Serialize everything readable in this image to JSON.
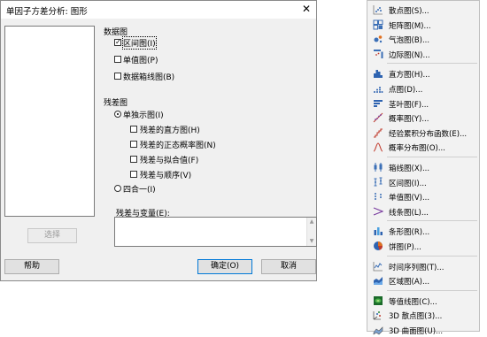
{
  "dialog": {
    "title": "单因子方差分析: 图形",
    "close": "✕",
    "select_button": "选择",
    "data_plots_heading": "数据图",
    "data_plots": [
      {
        "label": "区间图(I)",
        "checked": true
      },
      {
        "label": "单值图(P)",
        "checked": false
      },
      {
        "label": "数据箱线图(B)",
        "checked": false
      }
    ],
    "residual_heading": "残差图",
    "residual_options": {
      "individual": "单独示图(I)",
      "individual_selected": true,
      "items": [
        "残差的直方图(H)",
        "残差的正态概率图(N)",
        "残差与拟合值(F)",
        "残差与顺序(V)"
      ],
      "four_in_one": "四合一(I)"
    },
    "residual_vs_vars_label": "残差与变量(E):",
    "help_button": "帮助",
    "ok_button": "确定(O)",
    "cancel_button": "取消"
  },
  "menu": {
    "groups": [
      [
        {
          "label": "散点图(S)...",
          "icon": "scatter-icon",
          "color": "#3b6fb6"
        },
        {
          "label": "矩阵图(M)...",
          "icon": "matrix-icon",
          "color": "#3b6fb6"
        },
        {
          "label": "气泡图(B)...",
          "icon": "bubble-icon",
          "color": "#3b6fb6"
        },
        {
          "label": "边际图(N)...",
          "icon": "marginal-icon",
          "color": "#3b6fb6"
        }
      ],
      [
        {
          "label": "直方图(H)...",
          "icon": "histogram-icon",
          "color": "#2e63b0"
        },
        {
          "label": "点图(D)...",
          "icon": "dotplot-icon",
          "color": "#2e63b0"
        },
        {
          "label": "茎叶图(F)...",
          "icon": "stem-leaf-icon",
          "color": "#2e63b0"
        },
        {
          "label": "概率图(Y)...",
          "icon": "probability-icon",
          "color": "#7a3ea0"
        },
        {
          "label": "经验累积分布函数(E)...",
          "icon": "ecdf-icon",
          "color": "#c0392b"
        },
        {
          "label": "概率分布图(O)...",
          "icon": "distribution-icon",
          "color": "#c0392b"
        }
      ],
      [
        {
          "label": "箱线图(X)...",
          "icon": "boxplot-icon",
          "color": "#3b6fb6"
        },
        {
          "label": "区间图(I)...",
          "icon": "interval-icon",
          "color": "#3b6fb6"
        },
        {
          "label": "单值图(V)...",
          "icon": "individual-value-icon",
          "color": "#3b6fb6"
        },
        {
          "label": "线条图(L)...",
          "icon": "line-plot-icon",
          "color": "#7a3ea0"
        }
      ],
      [
        {
          "label": "条形图(R)...",
          "icon": "bar-chart-icon",
          "color": "#2e63b0"
        },
        {
          "label": "饼图(P)...",
          "icon": "pie-chart-icon",
          "color": "#e07020"
        }
      ],
      [
        {
          "label": "时间序列图(T)...",
          "icon": "time-series-icon",
          "color": "#3b6fb6"
        },
        {
          "label": "区域图(A)...",
          "icon": "area-graph-icon",
          "color": "#2e63b0"
        }
      ],
      [
        {
          "label": "等值线图(C)...",
          "icon": "contour-icon",
          "color": "#2a8a3a"
        },
        {
          "label": "3D 散点图(3)...",
          "icon": "scatter-3d-icon",
          "color": "#555555"
        },
        {
          "label": "3D 曲面图(U)...",
          "icon": "surface-3d-icon",
          "color": "#555555"
        }
      ]
    ]
  }
}
